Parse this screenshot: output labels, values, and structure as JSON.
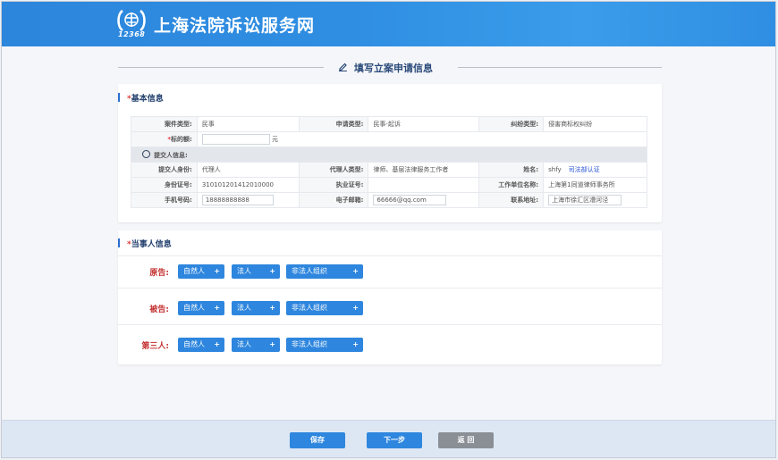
{
  "site": {
    "title": "上海法院诉讼服务网",
    "logo_number": "12368"
  },
  "page": {
    "title": "填写立案申请信息"
  },
  "basic": {
    "heading_star": "*",
    "heading": "基本信息",
    "case_type_label": "案件类型:",
    "case_type": "民事",
    "apply_type_label": "申请类型:",
    "apply_type": "民事-起诉",
    "dispute_type_label": "纠纷类型:",
    "dispute_type": "侵害商标权纠纷",
    "amount_star": "*",
    "amount_label": "标的额:",
    "amount_value": "",
    "amount_unit": "元",
    "submitter_label": "提交人信息:",
    "identity_label": "提交人身份:",
    "identity": "代理人",
    "agent_type_label": "代理人类型:",
    "agent_type": "律师、基层法律服务工作者",
    "name_label": "姓名:",
    "name": "shfy",
    "verify_link": "司法部认证",
    "id_label": "身份证号:",
    "id_number": "310101201412010000",
    "license_label": "执业证号:",
    "license": "",
    "workplace_label": "工作单位名称:",
    "workplace": "上海第1同道律师事务所",
    "phone_label": "手机号码:",
    "phone": "18888888888",
    "email_label": "电子邮箱:",
    "email": "66666@qq.com",
    "address_label": "联系地址:",
    "address": "上海市徐汇区漕河泾"
  },
  "parties": {
    "heading_star": "*",
    "heading": "当事人信息",
    "rows": [
      {
        "label": "原告:",
        "buttons": [
          "自然人",
          "法人",
          "非法人组织"
        ]
      },
      {
        "label": "被告:",
        "buttons": [
          "自然人",
          "法人",
          "非法人组织"
        ]
      },
      {
        "label": "第三人:",
        "buttons": [
          "自然人",
          "法人",
          "非法人组织"
        ]
      }
    ],
    "plus": "+"
  },
  "footer": {
    "save": "保存",
    "next": "下一步",
    "back": "返 回"
  },
  "colors": {
    "primary": "#2e86de",
    "header": "#2f8ee2",
    "required": "#e23a3a",
    "back_button": "#8a8f96"
  }
}
